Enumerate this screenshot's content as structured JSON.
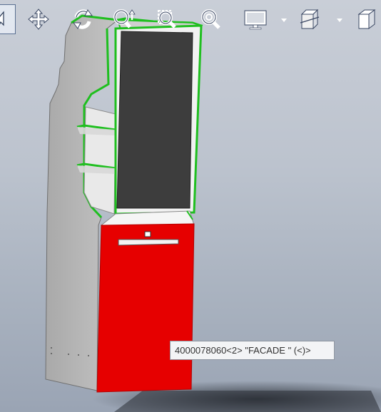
{
  "toolbar": {
    "buttons": [
      {
        "icon": "select-arrow-icon",
        "active": true
      },
      {
        "icon": "pan-icon"
      },
      {
        "icon": "rotate-icon"
      },
      {
        "icon": "zoom-in-out-icon"
      },
      {
        "icon": "zoom-to-area-icon"
      },
      {
        "icon": "zoom-to-fit-icon"
      },
      {
        "icon": "display-style-icon",
        "has_dropdown": true
      },
      {
        "icon": "section-view-icon",
        "has_dropdown": true
      },
      {
        "icon": "view-orientation-cube-icon"
      }
    ]
  },
  "model": {
    "colors": {
      "panel": "#b9b9b9",
      "edge_highlight": "#1fbf1f",
      "screen": "#3d3d3d",
      "facade": "#e60000"
    }
  },
  "tooltip": {
    "text": "4000078060<2> \"FACADE \" (<)>"
  }
}
